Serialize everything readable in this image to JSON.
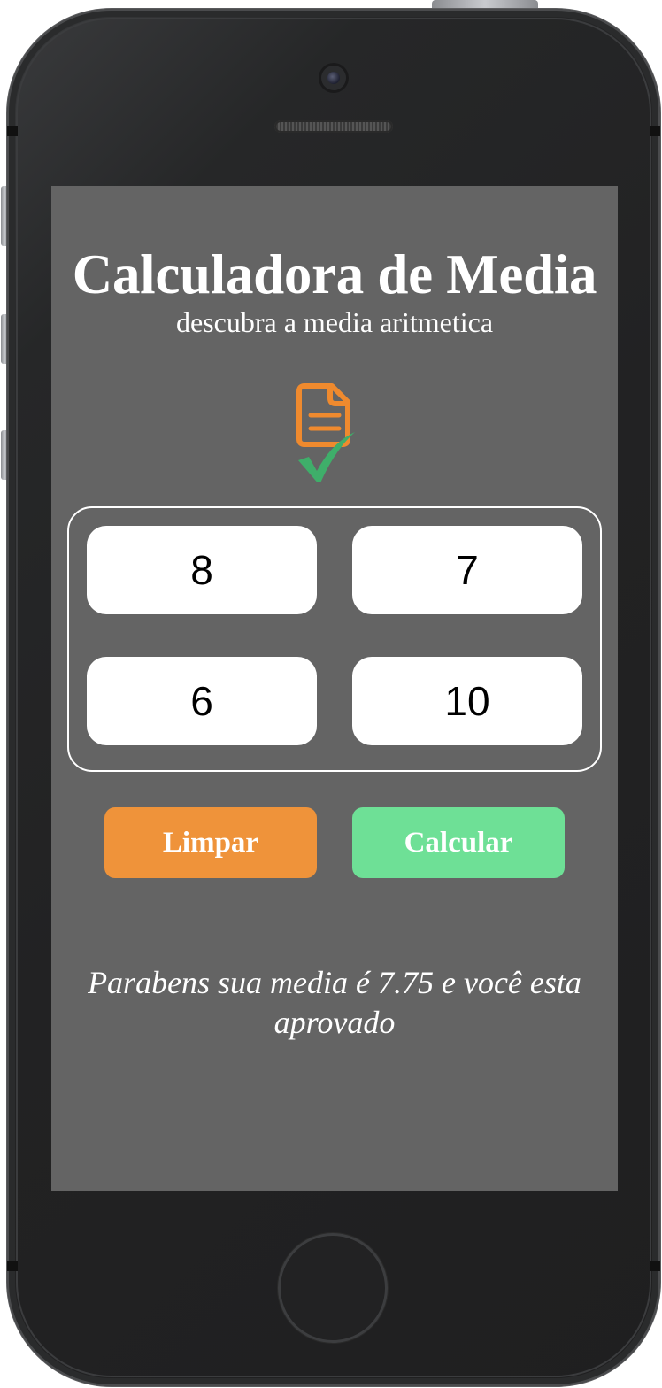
{
  "app": {
    "title": "Calculadora de Media",
    "subtitle": "descubra a media aritmetica"
  },
  "logo": {
    "icon": "document-check-icon",
    "colors": {
      "document": "#ef8a2e",
      "check": "#3fae6a"
    }
  },
  "grades": {
    "grade1": "8",
    "grade2": "7",
    "grade3": "6",
    "grade4": "10"
  },
  "buttons": {
    "clear_label": "Limpar",
    "calculate_label": "Calcular"
  },
  "result": {
    "message": "Parabens sua media é 7.75 e você esta aprovado"
  },
  "colors": {
    "screen_background": "#646464",
    "clear_button": "#ef933a",
    "calculate_button": "#6ee096"
  }
}
